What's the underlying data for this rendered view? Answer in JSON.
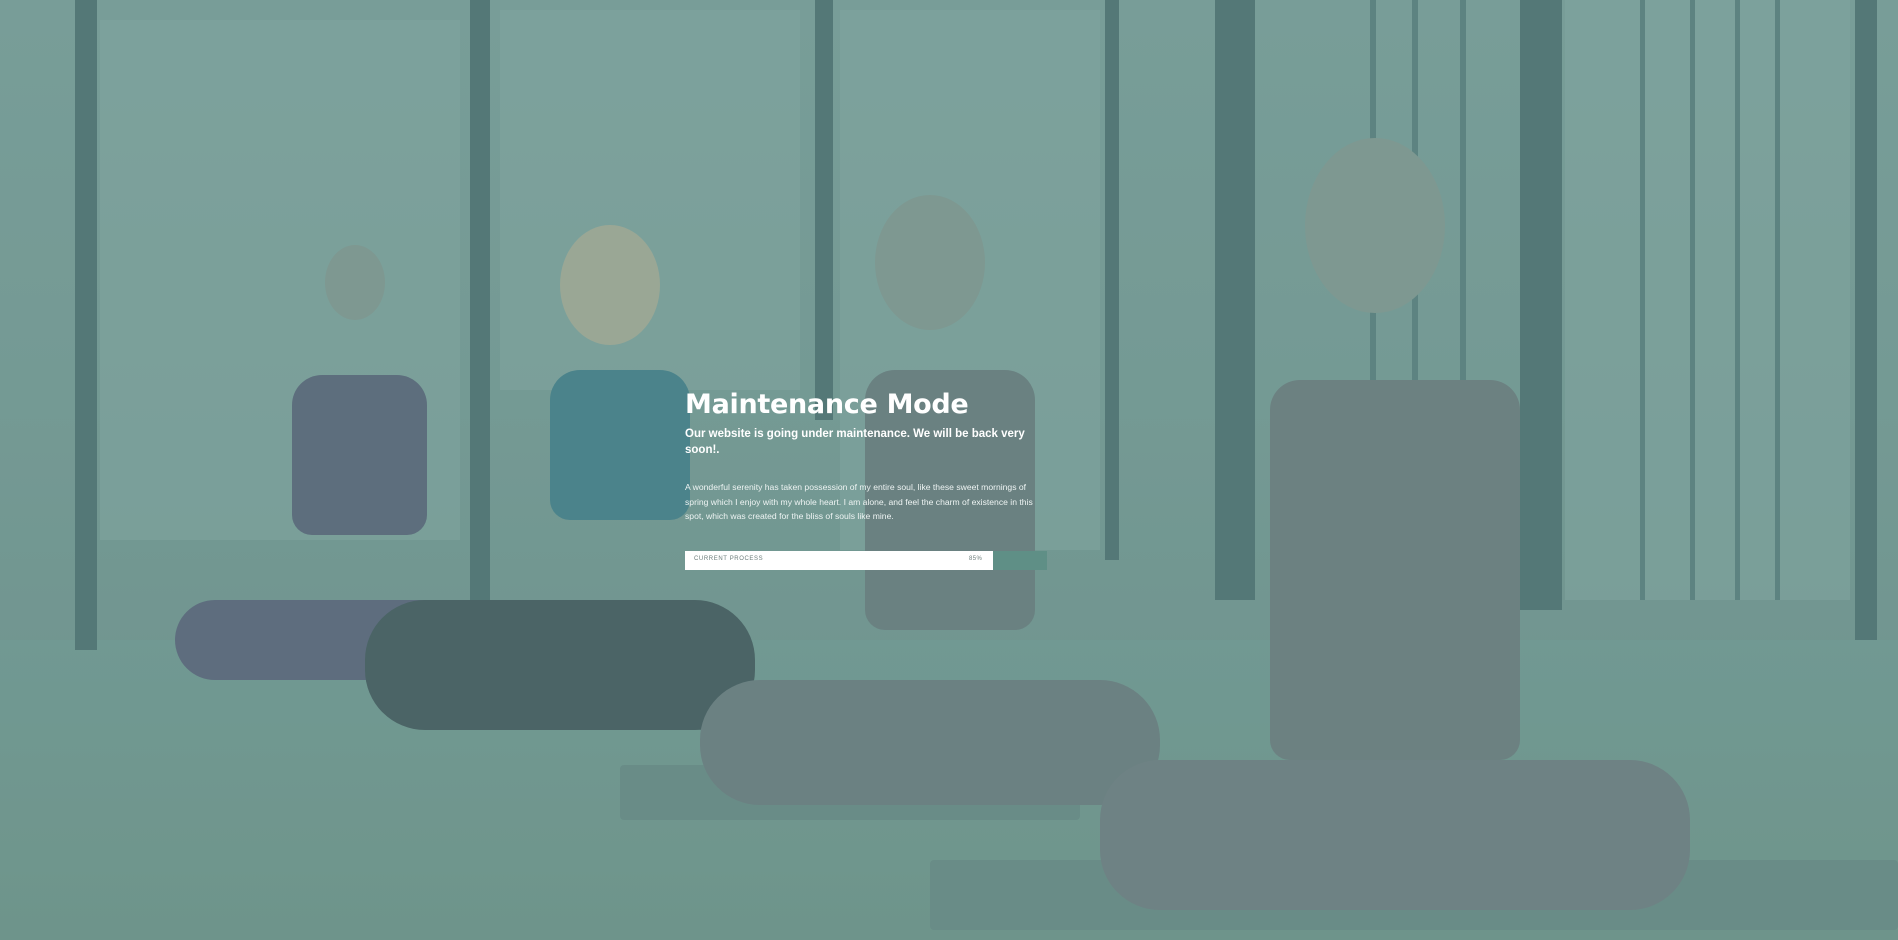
{
  "maintenance": {
    "title": "Maintenance Mode",
    "subtitle": "Our website is going under maintenance. We will be back very soon!.",
    "description": "A wonderful serenity has taken possession of my entire soul, like these sweet mornings of spring which I enjoy with my whole heart. I am alone, and feel the charm of existence in this spot, which was created for the bliss of souls like mine."
  },
  "progress": {
    "label": "CURRENT PROCESS",
    "value_text": "85%",
    "value": 0.85
  },
  "colors": {
    "overlay": "#6f9590",
    "accent": "#5f8f86",
    "text": "#ffffff"
  }
}
